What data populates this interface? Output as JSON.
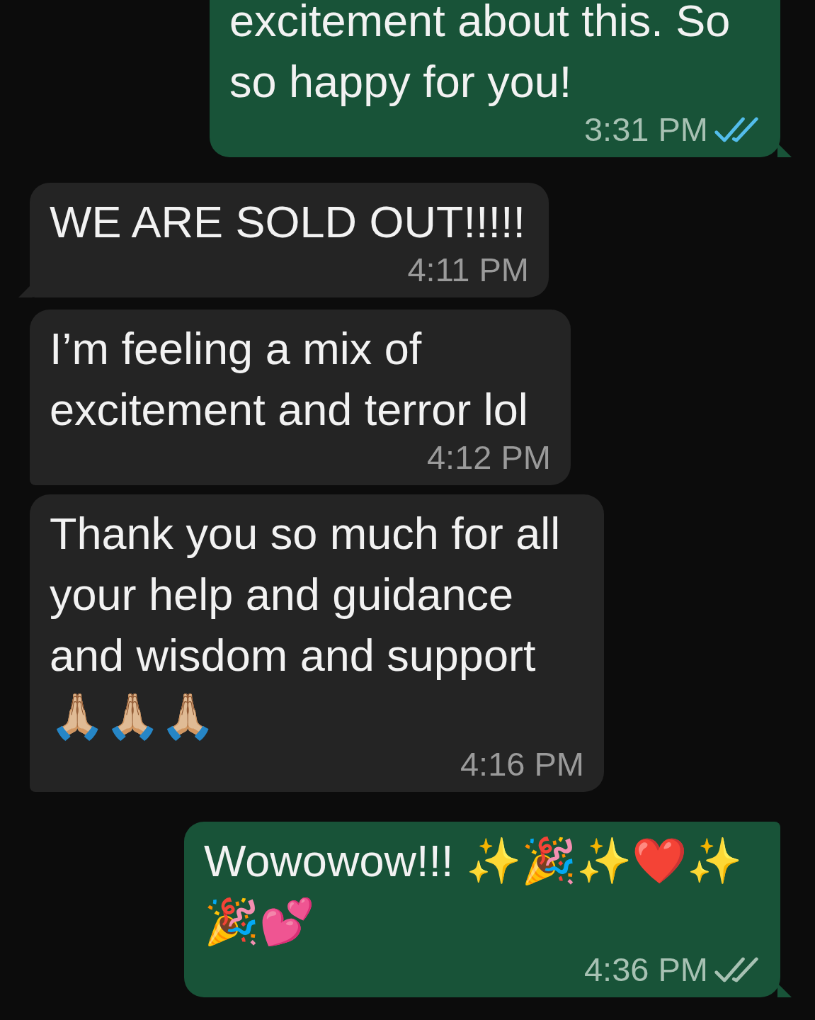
{
  "messages": [
    {
      "kind": "outgoing",
      "text": "excitement about this. So so happy for you!",
      "time": "3:31 PM",
      "read": true
    },
    {
      "kind": "incoming",
      "text": "WE ARE SOLD OUT!!!!!",
      "time": "4:11 PM",
      "tail": true
    },
    {
      "kind": "incoming",
      "text": "I’m feeling a mix of excitement and terror lol",
      "time": "4:12 PM",
      "tail": false
    },
    {
      "kind": "incoming",
      "text": "Thank you so much for all your help and guidance and wisdom and support 🙏🏼🙏🏼🙏🏼",
      "time": "4:16 PM",
      "tail": false
    },
    {
      "kind": "outgoing",
      "text": "Wowowow!!! ✨🎉✨❤️✨ 🎉💕",
      "time": "4:36 PM",
      "read": false
    }
  ]
}
